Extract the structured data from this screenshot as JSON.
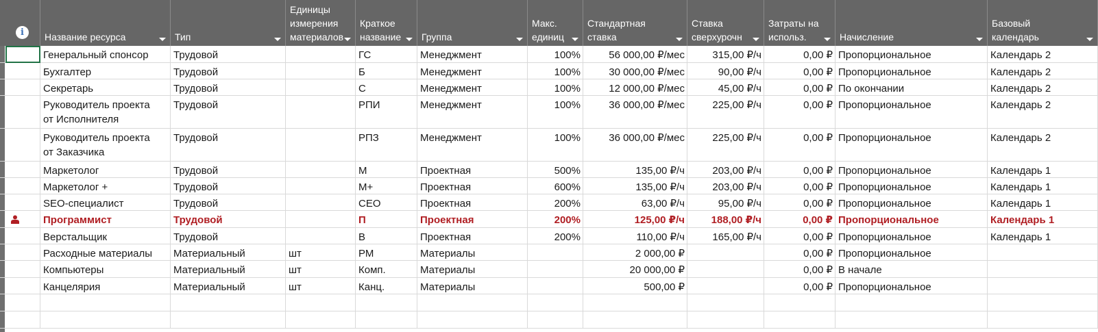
{
  "colors": {
    "header_bg": "#666666",
    "highlight_text": "#b01e23",
    "grid_line": "#d9d9d9"
  },
  "icons": {
    "info": "info-icon",
    "person": "person-indicator-icon"
  },
  "columns": [
    {
      "key": "name",
      "label": "Название ресурса"
    },
    {
      "key": "type",
      "label": "Тип"
    },
    {
      "key": "units",
      "label": "Единицы\nизмерения\nматериалов"
    },
    {
      "key": "short",
      "label": "Краткое\nназвание"
    },
    {
      "key": "group",
      "label": "Группа"
    },
    {
      "key": "max",
      "label": "Макс.\nединиц"
    },
    {
      "key": "std",
      "label": "Стандартная\nставка"
    },
    {
      "key": "ovt",
      "label": "Ставка\nсверхурочн"
    },
    {
      "key": "cost",
      "label": "Затраты на\nиспольз."
    },
    {
      "key": "accrue",
      "label": "Начисление"
    },
    {
      "key": "cal",
      "label": "Базовый\nкалендарь"
    }
  ],
  "rows": [
    {
      "name": "Генеральный спонсор",
      "type": "Трудовой",
      "units": "",
      "short": "ГС",
      "group": "Менеджмент",
      "max": "100%",
      "std": "56 000,00 ₽/мес",
      "ovt": "315,00 ₽/ч",
      "cost": "0,00 ₽",
      "accrue": "Пропорциональное",
      "cal": "Календарь 2"
    },
    {
      "name": "Бухгалтер",
      "type": "Трудовой",
      "units": "",
      "short": "Б",
      "group": "Менеджмент",
      "max": "100%",
      "std": "30 000,00 ₽/мес",
      "ovt": "90,00 ₽/ч",
      "cost": "0,00 ₽",
      "accrue": "Пропорциональное",
      "cal": "Календарь 2"
    },
    {
      "name": "Секретарь",
      "type": "Трудовой",
      "units": "",
      "short": "С",
      "group": "Менеджмент",
      "max": "100%",
      "std": "12 000,00 ₽/мес",
      "ovt": "45,00 ₽/ч",
      "cost": "0,00 ₽",
      "accrue": "По окончании",
      "cal": "Календарь 2"
    },
    {
      "name": "Руководитель проекта\nот Исполнителя",
      "type": "Трудовой",
      "units": "",
      "short": "РПИ",
      "group": "Менеджмент",
      "max": "100%",
      "std": "36 000,00 ₽/мес",
      "ovt": "225,00 ₽/ч",
      "cost": "0,00 ₽",
      "accrue": "Пропорциональное",
      "cal": "Календарь 2"
    },
    {
      "name": "Руководитель проекта\nот Заказчика",
      "type": "Трудовой",
      "units": "",
      "short": "РПЗ",
      "group": "Менеджмент",
      "max": "100%",
      "std": "36 000,00 ₽/мес",
      "ovt": "225,00 ₽/ч",
      "cost": "0,00 ₽",
      "accrue": "Пропорциональное",
      "cal": "Календарь 2"
    },
    {
      "name": "Маркетолог",
      "type": "Трудовой",
      "units": "",
      "short": "М",
      "group": "Проектная",
      "max": "500%",
      "std": "135,00 ₽/ч",
      "ovt": "203,00 ₽/ч",
      "cost": "0,00 ₽",
      "accrue": "Пропорциональное",
      "cal": "Календарь 1"
    },
    {
      "name": "Маркетолог +",
      "type": "Трудовой",
      "units": "",
      "short": "М+",
      "group": "Проектная",
      "max": "600%",
      "std": "135,00 ₽/ч",
      "ovt": "203,00 ₽/ч",
      "cost": "0,00 ₽",
      "accrue": "Пропорциональное",
      "cal": "Календарь 1"
    },
    {
      "name": "SEO-специалист",
      "type": "Трудовой",
      "units": "",
      "short": "СЕО",
      "group": "Проектная",
      "max": "200%",
      "std": "63,00 ₽/ч",
      "ovt": "95,00 ₽/ч",
      "cost": "0,00 ₽",
      "accrue": "Пропорциональное",
      "cal": "Календарь 1"
    },
    {
      "name": "Программист",
      "type": "Трудовой",
      "units": "",
      "short": "П",
      "group": "Проектная",
      "max": "200%",
      "std": "125,00 ₽/ч",
      "ovt": "188,00 ₽/ч",
      "cost": "0,00 ₽",
      "accrue": "Пропорциональное",
      "cal": "Календарь 1",
      "overallocated": true
    },
    {
      "name": "Верстальщик",
      "type": "Трудовой",
      "units": "",
      "short": "В",
      "group": "Проектная",
      "max": "200%",
      "std": "110,00 ₽/ч",
      "ovt": "165,00 ₽/ч",
      "cost": "0,00 ₽",
      "accrue": "Пропорциональное",
      "cal": "Календарь 1"
    },
    {
      "name": "Расходные материалы",
      "type": "Материальный",
      "units": "шт",
      "short": "РМ",
      "group": "Материалы",
      "max": "",
      "std": "2 000,00 ₽",
      "ovt": "",
      "cost": "0,00 ₽",
      "accrue": "Пропорциональное",
      "cal": ""
    },
    {
      "name": "Компьютеры",
      "type": "Материальный",
      "units": "шт",
      "short": "Комп.",
      "group": "Материалы",
      "max": "",
      "std": "20 000,00 ₽",
      "ovt": "",
      "cost": "0,00 ₽",
      "accrue": "В начале",
      "cal": ""
    },
    {
      "name": "Канцелярия",
      "type": "Материальный",
      "units": "шт",
      "short": "Канц.",
      "group": "Материалы",
      "max": "",
      "std": "500,00 ₽",
      "ovt": "",
      "cost": "0,00 ₽",
      "accrue": "Пропорциональное",
      "cal": ""
    },
    {
      "name": "",
      "type": "",
      "units": "",
      "short": "",
      "group": "",
      "max": "",
      "std": "",
      "ovt": "",
      "cost": "",
      "accrue": "",
      "cal": ""
    },
    {
      "name": "",
      "type": "",
      "units": "",
      "short": "",
      "group": "",
      "max": "",
      "std": "",
      "ovt": "",
      "cost": "",
      "accrue": "",
      "cal": ""
    }
  ]
}
